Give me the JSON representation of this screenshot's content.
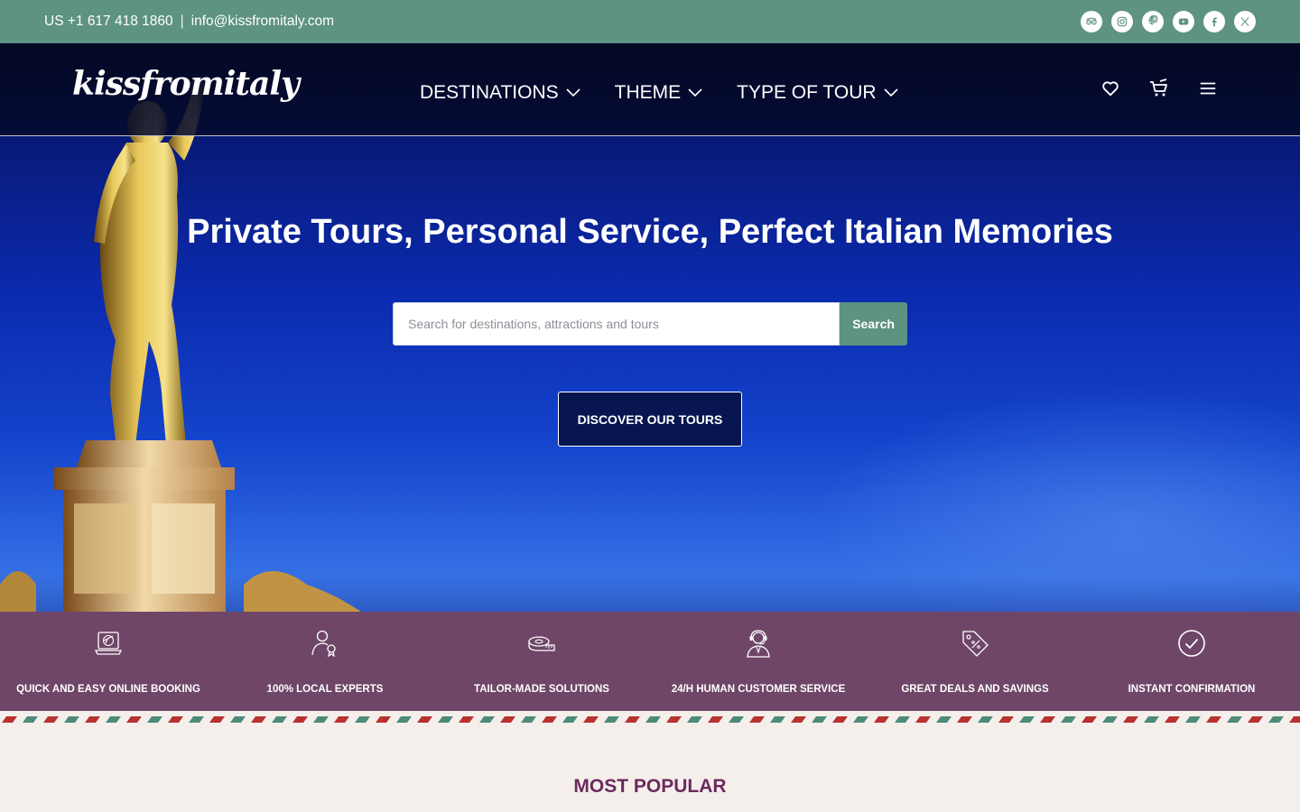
{
  "topbar": {
    "phone": "US +1 617 418 1860",
    "separator": "|",
    "email": "info@kissfromitaly.com",
    "socials": [
      "tripadvisor-icon",
      "instagram-icon",
      "pinterest-icon",
      "youtube-icon",
      "facebook-icon",
      "x-icon"
    ],
    "color": "#5e9282"
  },
  "nav": {
    "logo": "kissfromitaly",
    "menu": [
      {
        "label": "DESTINATIONS"
      },
      {
        "label": "THEME"
      },
      {
        "label": "TYPE OF TOUR"
      }
    ],
    "icons": [
      "heart-icon",
      "cart-icon",
      "hamburger-icon"
    ]
  },
  "hero": {
    "headline": "Private Tours, Personal Service, Perfect Italian Memories",
    "search": {
      "placeholder": "Search for destinations, attractions and tours",
      "value": "",
      "button": "Search"
    },
    "cta": "DISCOVER OUR TOURS"
  },
  "features": {
    "color": "#6f4668",
    "items": [
      {
        "icon": "laptop-booking-icon",
        "label": "QUICK AND EASY ONLINE BOOKING"
      },
      {
        "icon": "local-expert-icon",
        "label": "100% LOCAL EXPERTS"
      },
      {
        "icon": "measuring-tape-icon",
        "label": "TAILOR-MADE SOLUTIONS"
      },
      {
        "icon": "headset-agent-icon",
        "label": "24/H HUMAN CUSTOMER SERVICE"
      },
      {
        "icon": "deal-tag-icon",
        "label": "GREAT DEALS AND SAVINGS"
      },
      {
        "icon": "check-circle-icon",
        "label": "INSTANT CONFIRMATION"
      }
    ]
  },
  "section": {
    "title": "MOST POPULAR",
    "color": "#6b2a5e"
  }
}
